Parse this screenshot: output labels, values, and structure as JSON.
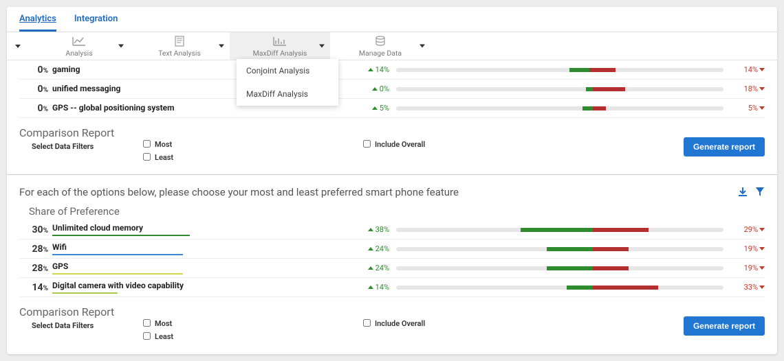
{
  "tabs": {
    "active": "Analytics",
    "other": "Integration"
  },
  "tools": {
    "analysis": "Analysis",
    "text": "Text Analysis",
    "maxdiff": "MaxDiff Analysis",
    "manage": "Manage Data"
  },
  "dropdown": {
    "conjoint": "Conjoint Analysis",
    "maxdiff": "MaxDiff Analysis"
  },
  "rows_top": [
    {
      "pct": "0",
      "name": "gaming",
      "green": "14%",
      "bar_green_l": 53,
      "bar_green_w": 6,
      "bar_red_l": 59,
      "bar_red_w": 8,
      "red": "14%"
    },
    {
      "pct": "0",
      "name": "unified messaging",
      "green": "0%",
      "bar_green_l": 58,
      "bar_green_w": 2,
      "bar_red_l": 60,
      "bar_red_w": 10,
      "red": "18%"
    },
    {
      "pct": "0",
      "name": "GPS -- global positioning system",
      "green": "5%",
      "bar_green_l": 57,
      "bar_green_w": 3,
      "bar_red_l": 60,
      "bar_red_w": 4,
      "red": "5%"
    }
  ],
  "comp": {
    "title": "Comparison Report",
    "filters": "Select Data Filters",
    "most": "Most",
    "least": "Least",
    "overall": "Include Overall",
    "gen": "Generate report"
  },
  "question": "For each of the options below, please choose your most and least preferred smart phone feature",
  "sop": "Share of Preference",
  "rows_bottom": [
    {
      "pct": "30",
      "name": "Unlimited cloud memory",
      "green": "38%",
      "ul_color": "#2e8b2e",
      "ul_w": 200,
      "bar_green_l": 38,
      "bar_green_w": 22,
      "bar_red_l": 60,
      "bar_red_w": 17,
      "red": "29%"
    },
    {
      "pct": "28",
      "name": "Wifi",
      "green": "24%",
      "ul_color": "#3a87d6",
      "ul_w": 190,
      "bar_green_l": 46,
      "bar_green_w": 14,
      "bar_red_l": 60,
      "bar_red_w": 11,
      "red": "19%"
    },
    {
      "pct": "28",
      "name": "GPS",
      "green": "24%",
      "ul_color": "#d0d54a",
      "ul_w": 190,
      "bar_green_l": 46,
      "bar_green_w": 14,
      "bar_red_l": 60,
      "bar_red_w": 11,
      "red": "19%"
    },
    {
      "pct": "14",
      "name": "Digital camera with video capability",
      "green": "14%",
      "ul_color": "#a8c94a",
      "ul_w": 95,
      "bar_green_l": 52,
      "bar_green_w": 8,
      "bar_red_l": 60,
      "bar_red_w": 20,
      "red": "33%"
    }
  ]
}
